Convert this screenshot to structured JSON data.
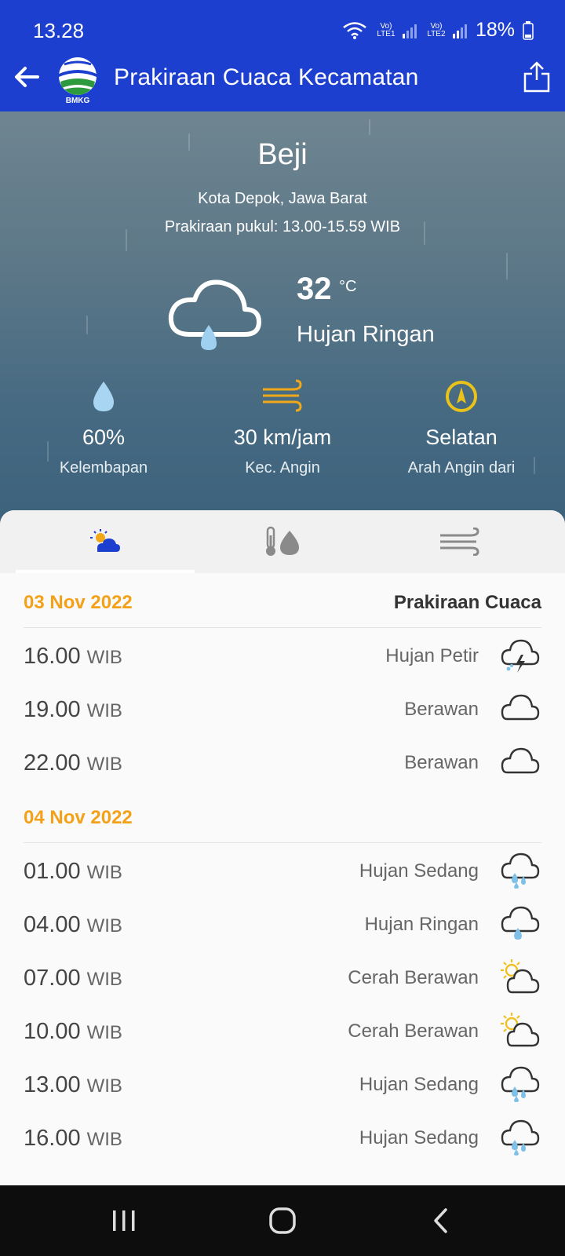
{
  "status_bar": {
    "time": "13.28",
    "sim1": "Vo) LTE1",
    "sim2": "Vo) LTE2",
    "battery": "18%"
  },
  "app_bar": {
    "title": "Prakiraan Cuaca Kecamatan",
    "logo_text": "BMKG"
  },
  "current": {
    "location": "Beji",
    "region": "Kota Depok, Jawa Barat",
    "forecast_time": "Prakiraan pukul: 13.00-15.59 WIB",
    "temperature": "32",
    "temperature_unit": "°C",
    "condition": "Hujan Ringan",
    "condition_icon": "cloud-drizzle-icon",
    "stats": [
      {
        "value": "60%",
        "label": "Kelembapan",
        "icon": "humidity-drop-icon"
      },
      {
        "value": "30 km/jam",
        "label": "Kec. Angin",
        "icon": "wind-speed-icon"
      },
      {
        "value": "Selatan",
        "label": "Arah Angin dari",
        "icon": "compass-icon"
      }
    ]
  },
  "tabs": [
    {
      "icon": "weather-tab-icon",
      "selected": true
    },
    {
      "icon": "temperature-humidity-tab-icon",
      "selected": false
    },
    {
      "icon": "wind-tab-icon",
      "selected": false
    }
  ],
  "forecast": {
    "column_title": "Prakiraan Cuaca",
    "time_suffix": "WIB",
    "days": [
      {
        "date": "03 Nov 2022",
        "rows": [
          {
            "time": "16.00",
            "condition": "Hujan Petir",
            "icon": "thunderstorm-icon"
          },
          {
            "time": "19.00",
            "condition": "Berawan",
            "icon": "cloud-icon"
          },
          {
            "time": "22.00",
            "condition": "Berawan",
            "icon": "cloud-icon"
          }
        ]
      },
      {
        "date": "04 Nov 2022",
        "rows": [
          {
            "time": "01.00",
            "condition": "Hujan Sedang",
            "icon": "moderate-rain-icon"
          },
          {
            "time": "04.00",
            "condition": "Hujan Ringan",
            "icon": "light-rain-icon"
          },
          {
            "time": "07.00",
            "condition": "Cerah Berawan",
            "icon": "partly-cloudy-icon"
          },
          {
            "time": "10.00",
            "condition": "Cerah Berawan",
            "icon": "partly-cloudy-icon"
          },
          {
            "time": "13.00",
            "condition": "Hujan Sedang",
            "icon": "moderate-rain-icon"
          },
          {
            "time": "16.00",
            "condition": "Hujan Sedang",
            "icon": "moderate-rain-icon"
          }
        ]
      }
    ]
  },
  "colors": {
    "app_bar": "#1d3fcf",
    "date_accent": "#f4a11a",
    "wind_icon": "#f0a818",
    "compass_icon": "#e9c21a",
    "rain_drop": "#8ec8ee"
  }
}
